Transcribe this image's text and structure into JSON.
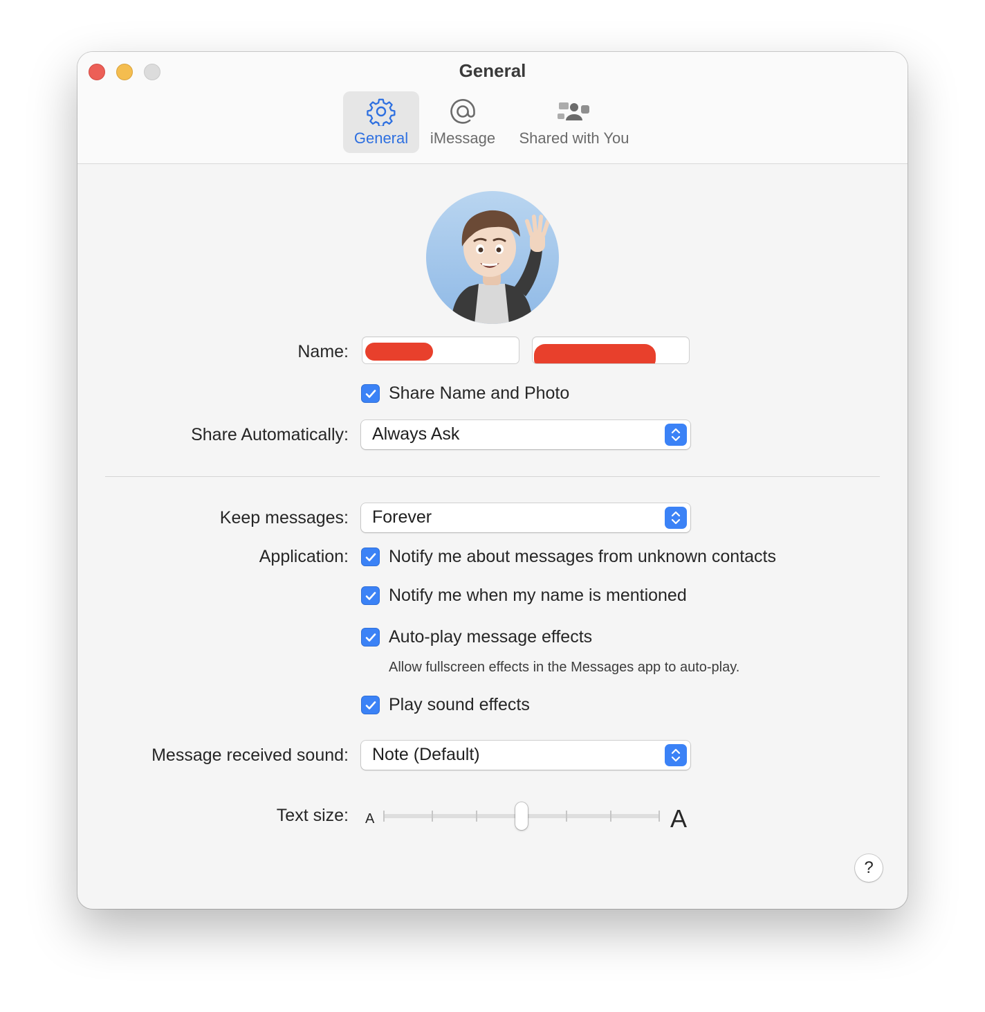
{
  "window": {
    "title": "General"
  },
  "toolbar": {
    "tabs": [
      {
        "label": "General",
        "icon": "gear-icon",
        "active": true
      },
      {
        "label": "iMessage",
        "icon": "at-sign-icon",
        "active": false
      },
      {
        "label": "Shared with You",
        "icon": "shared-people-icon",
        "active": false
      }
    ]
  },
  "profile": {
    "name_label": "Name:",
    "first_name": "",
    "last_name": "",
    "share_name_photo": {
      "label": "Share Name and Photo",
      "checked": true
    },
    "share_automatically_label": "Share Automatically:",
    "share_automatically_value": "Always Ask"
  },
  "settings": {
    "keep_messages_label": "Keep messages:",
    "keep_messages_value": "Forever",
    "application_label": "Application:",
    "options": [
      {
        "label": "Notify me about messages from unknown contacts",
        "checked": true
      },
      {
        "label": "Notify me when my name is mentioned",
        "checked": true
      },
      {
        "label": "Auto-play message effects",
        "checked": true
      },
      {
        "label": "Play sound effects",
        "checked": true
      }
    ],
    "autoplay_hint": "Allow fullscreen effects in the Messages app to auto-play.",
    "received_sound_label": "Message received sound:",
    "received_sound_value": "Note (Default)",
    "text_size_label": "Text size:",
    "text_size_small": "A",
    "text_size_large": "A",
    "text_size_level": 0.5
  },
  "help_button": "?",
  "colors": {
    "accent": "#3b82f6",
    "redaction": "#e8402c"
  }
}
